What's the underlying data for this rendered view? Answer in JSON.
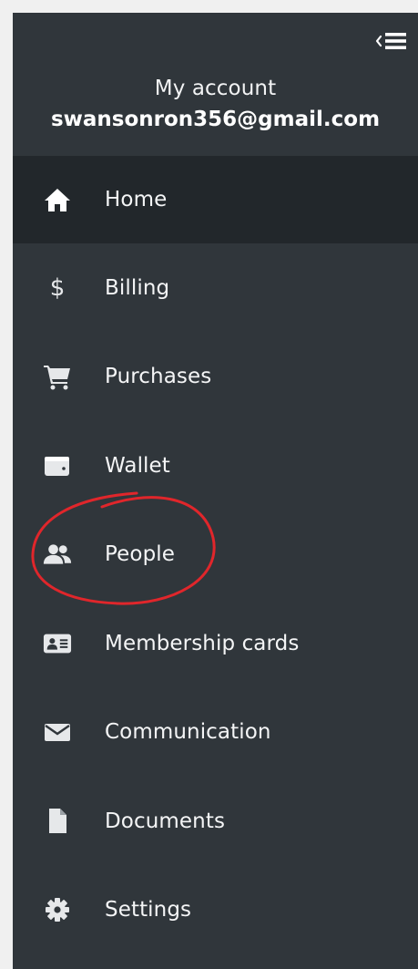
{
  "account": {
    "title": "My account",
    "email": "swansonron356@gmail.com"
  },
  "nav": {
    "items": [
      {
        "label": "Home",
        "icon": "home-icon",
        "active": true
      },
      {
        "label": "Billing",
        "icon": "dollar-icon",
        "active": false
      },
      {
        "label": "Purchases",
        "icon": "cart-icon",
        "active": false
      },
      {
        "label": "Wallet",
        "icon": "wallet-icon",
        "active": false
      },
      {
        "label": "People",
        "icon": "people-icon",
        "active": false
      },
      {
        "label": "Membership cards",
        "icon": "id-card-icon",
        "active": false
      },
      {
        "label": "Communication",
        "icon": "envelope-icon",
        "active": false
      },
      {
        "label": "Documents",
        "icon": "document-icon",
        "active": false
      },
      {
        "label": "Settings",
        "icon": "gear-icon",
        "active": false
      }
    ],
    "billing_glyph": "$"
  },
  "colors": {
    "sidebar_bg": "#30363b",
    "active_bg": "#22272b",
    "text": "#f4f5f6",
    "annotation": "#e0262b"
  }
}
